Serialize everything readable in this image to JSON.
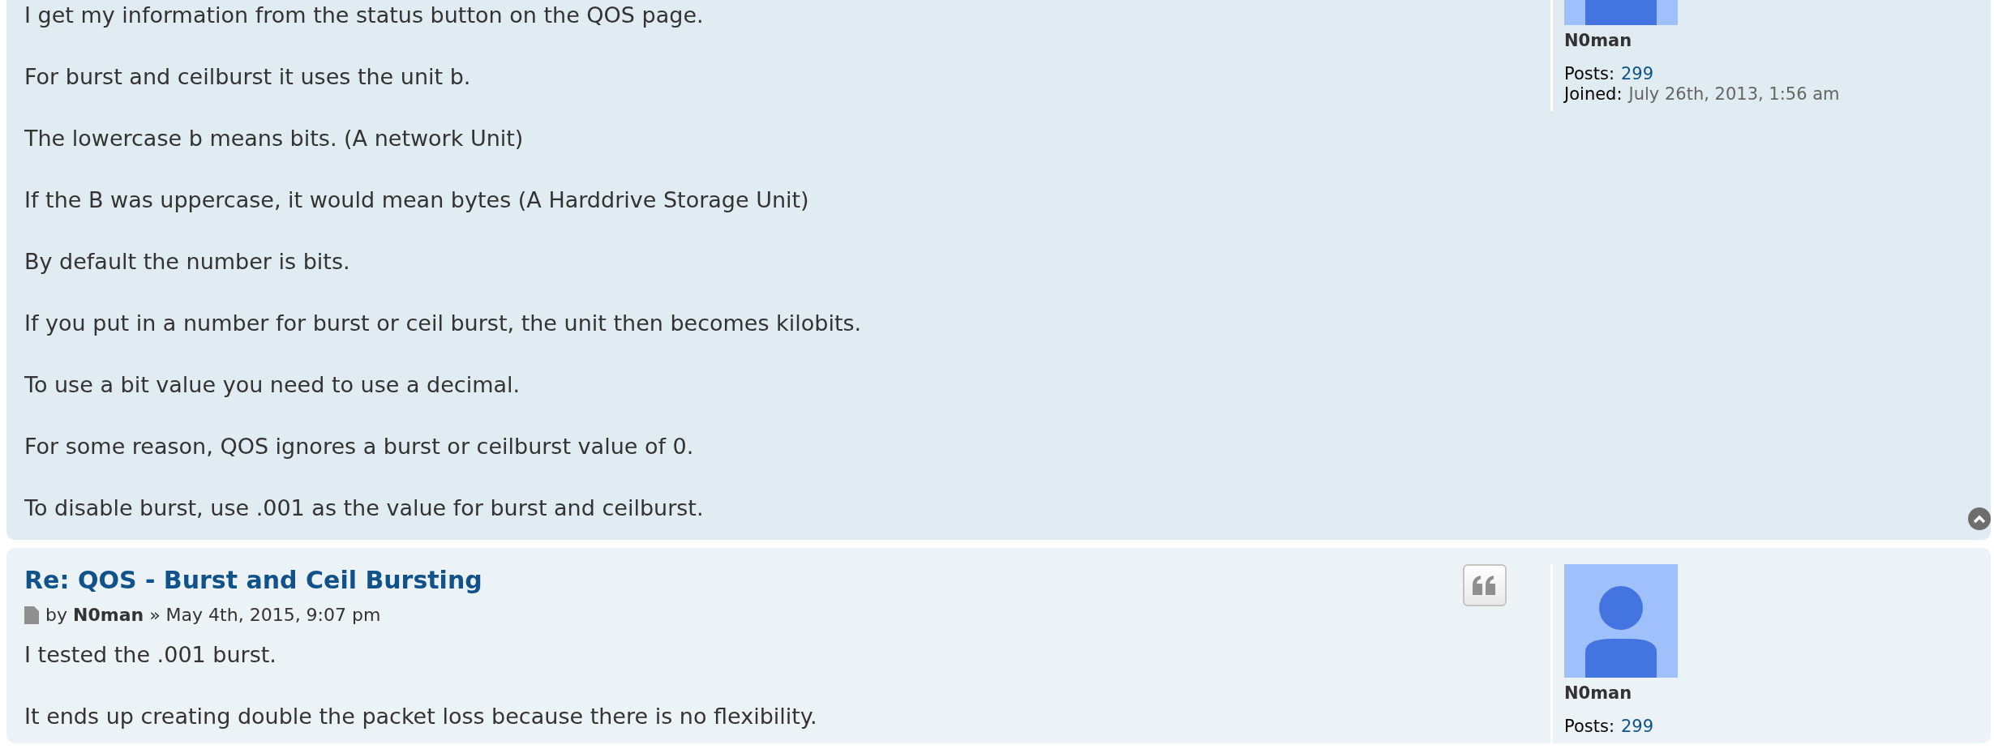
{
  "posts": [
    {
      "body": [
        "I get my information from the status button on the QOS page.",
        "For burst and ceilburst it uses the unit b.",
        "The lowercase b means bits. (A network Unit)",
        "If the B was uppercase, it would mean bytes (A Harddrive Storage Unit)",
        "By default the number is bits.",
        "If you put in a number for burst or ceil burst, the unit then becomes kilobits.",
        "To use a bit value you need to use a decimal.",
        "For some reason, QOS ignores a burst or ceilburst value of 0.",
        "To disable burst, use .001 as the value for burst and ceilburst."
      ],
      "author": {
        "name": "N0man",
        "posts_label": "Posts:",
        "posts": "299",
        "joined_label": "Joined:",
        "joined": "July 26th, 2013, 1:56 am"
      },
      "avatar_cropped": true,
      "back_to_top": true,
      "quote": false
    },
    {
      "title": "Re: QOS - Burst and Ceil Bursting",
      "byline": {
        "by": "by",
        "author": "N0man",
        "sep": "»",
        "date": "May 4th, 2015, 9:07 pm"
      },
      "body": [
        "I tested the .001 burst.",
        "It ends up creating double the packet loss because there is no flexibility."
      ],
      "author": {
        "name": "N0man",
        "posts_label": "Posts:",
        "posts": "299"
      },
      "avatar_cropped": false,
      "back_to_top": false,
      "quote": true
    }
  ]
}
